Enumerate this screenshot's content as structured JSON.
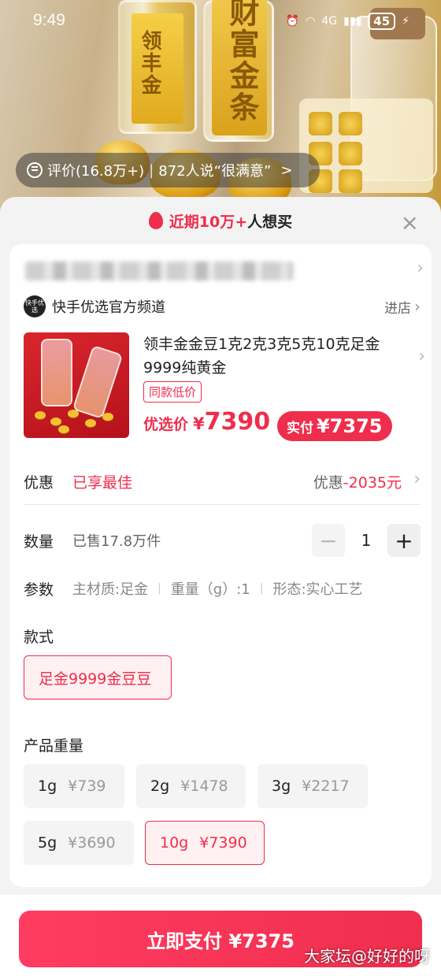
{
  "status": {
    "time": "9:49",
    "network": "4G",
    "battery": "45"
  },
  "hero": {
    "bar_text_left": "领丰金",
    "bar_text_right": "财富金条",
    "review": {
      "label": "评价(16.8万+)",
      "separator": "|",
      "satisfied": "872人说“很满意”",
      "chevron": ">"
    }
  },
  "sheet": {
    "header_hot": "近期10万+",
    "header_rest": "人想买",
    "close": "×"
  },
  "store": {
    "logo_text": "快手优选",
    "name": "快手优选官方频道",
    "enter": "进店"
  },
  "product": {
    "title": "领丰金金豆1克2克3克5克10克足金9999纯黄金",
    "tag": "同款低价",
    "price_label": "优选价",
    "currency": "¥",
    "price": "7390",
    "paid_label": "实付",
    "paid_price": "¥7375"
  },
  "discount": {
    "label": "优惠",
    "value": "已享最佳",
    "right_label": "优惠",
    "right_amount": "-2035元"
  },
  "quantity": {
    "label": "数量",
    "sold": "已售17.8万件",
    "minus": "−",
    "value": "1",
    "plus": "+"
  },
  "params": {
    "label": "参数",
    "items": [
      "主材质:足金",
      "重量（g）:1",
      "形态:实心工艺"
    ],
    "sep": "|"
  },
  "style_section": {
    "title": "款式",
    "options": [
      {
        "label": "足金9999金豆豆",
        "selected": true
      }
    ]
  },
  "weight_section": {
    "title": "产品重量",
    "options": [
      {
        "label": "1g",
        "price": "¥739",
        "selected": false
      },
      {
        "label": "2g",
        "price": "¥1478",
        "selected": false
      },
      {
        "label": "3g",
        "price": "¥2217",
        "selected": false
      },
      {
        "label": "5g",
        "price": "¥3690",
        "selected": false
      },
      {
        "label": "10g",
        "price": "¥7390",
        "selected": true
      }
    ]
  },
  "pay_button": "立即支付 ¥7375",
  "watermark": "大家坛@好好的呀",
  "colors": {
    "accent": "#ef2d4c",
    "background": "#f3f3f3"
  }
}
